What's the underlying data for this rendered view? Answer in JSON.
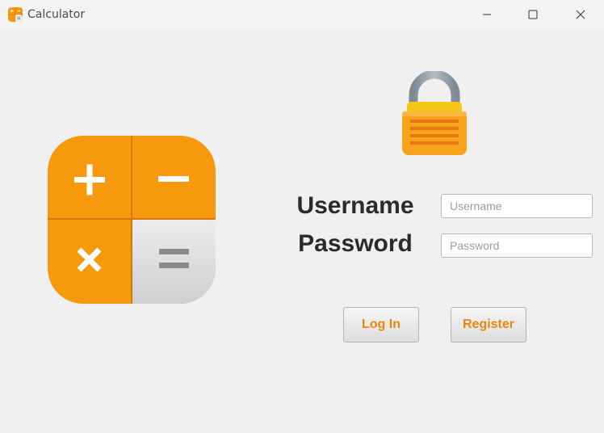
{
  "window": {
    "title": "Calculator",
    "controls": {
      "minimize": "minimize-icon",
      "maximize": "maximize-icon",
      "close": "close-icon"
    }
  },
  "logo": {
    "keys": [
      "+",
      "−",
      "×",
      "="
    ],
    "accent": "#f7990c",
    "neutral": "#d9d9d9"
  },
  "lock": {
    "icon": "padlock-icon",
    "body_color": "#f7a21b",
    "shackle_color": "#8e9aa3"
  },
  "form": {
    "username_label": "Username",
    "password_label": "Password",
    "username_placeholder": "Username",
    "password_placeholder": "Password",
    "username_value": "",
    "password_value": ""
  },
  "buttons": {
    "login_label": "Log In",
    "register_label": "Register",
    "text_color": "#e8860c"
  }
}
